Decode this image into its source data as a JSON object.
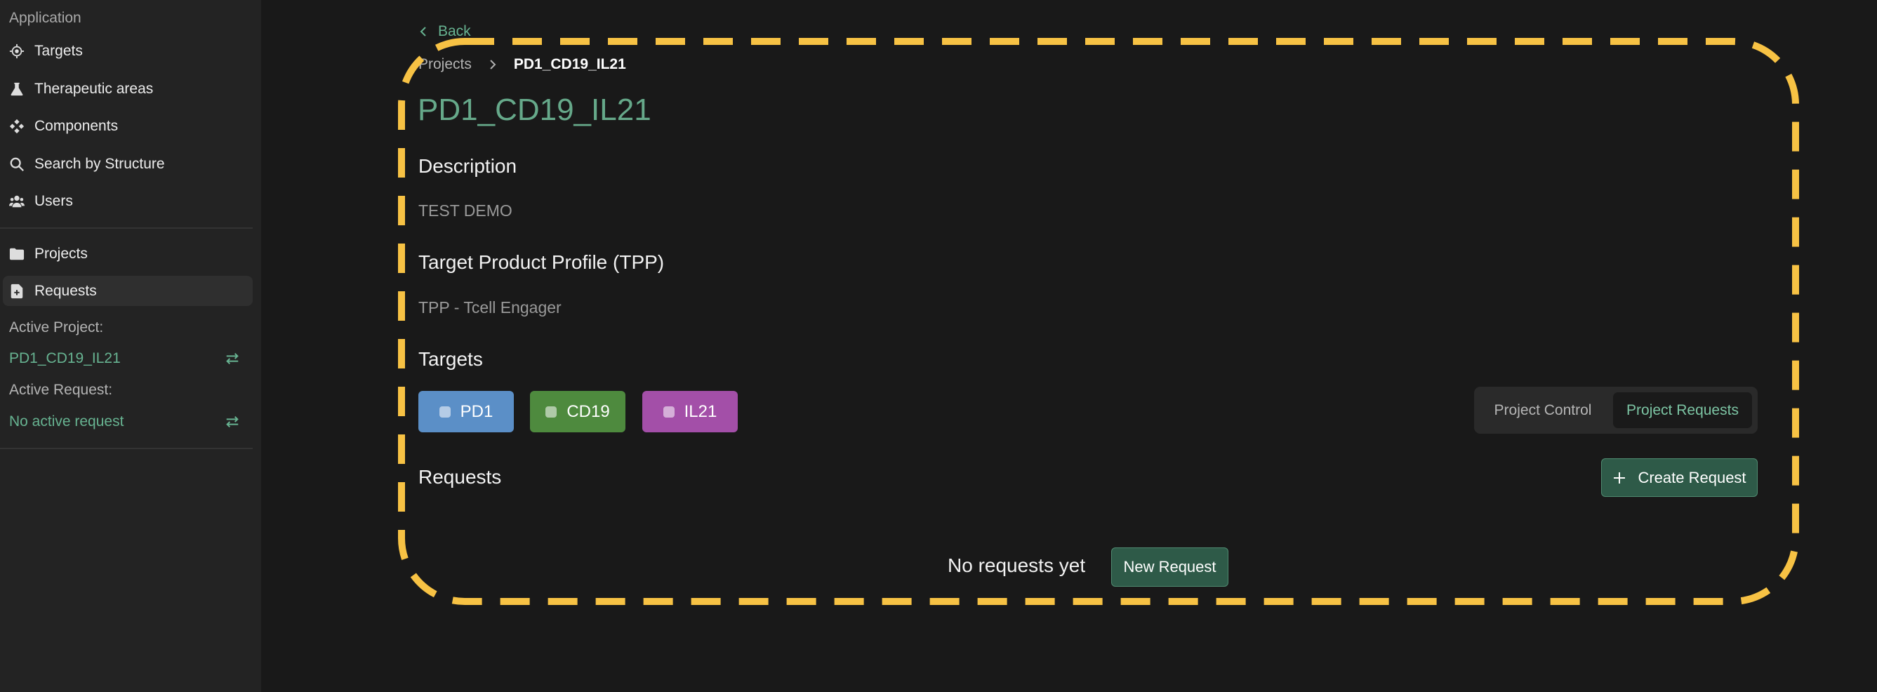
{
  "sidebar": {
    "section_title": "Application",
    "items": [
      {
        "label": "Targets",
        "icon": "crosshair-icon"
      },
      {
        "label": "Therapeutic areas",
        "icon": "flask-icon"
      },
      {
        "label": "Components",
        "icon": "components-icon"
      },
      {
        "label": "Search by Structure",
        "icon": "search-icon"
      },
      {
        "label": "Users",
        "icon": "users-icon"
      },
      {
        "label": "Projects",
        "icon": "folder-icon"
      },
      {
        "label": "Requests",
        "icon": "file-plus-icon"
      }
    ],
    "active_project_label": "Active Project:",
    "active_project_value": "PD1_CD19_IL21",
    "active_request_label": "Active Request:",
    "active_request_value": "No active request"
  },
  "main": {
    "back_label": "Back",
    "breadcrumb": [
      "Projects",
      "PD1_CD19_IL21"
    ],
    "title": "PD1_CD19_IL21",
    "description_heading": "Description",
    "description_text": "TEST DEMO",
    "tpp_heading": "Target Product Profile (TPP)",
    "tpp_text": "TPP - Tcell Engager",
    "targets_heading": "Targets",
    "targets": [
      {
        "label": "PD1",
        "color": "#5b8fc7"
      },
      {
        "label": "CD19",
        "color": "#4e8a3e"
      },
      {
        "label": "IL21",
        "color": "#a34fa8"
      }
    ],
    "tabs": [
      "Project Control",
      "Project Requests"
    ],
    "requests_heading": "Requests",
    "create_request_label": "Create Request",
    "empty_text": "No requests yet",
    "new_request_label": "New Request"
  },
  "colors": {
    "accent": "#67b391",
    "highlight": "#f7c244"
  }
}
